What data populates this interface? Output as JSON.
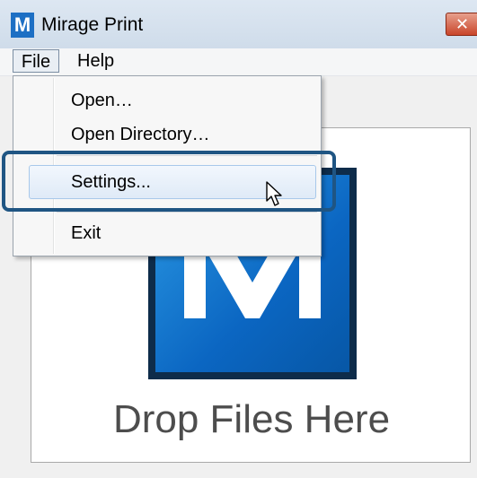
{
  "window": {
    "title": "Mirage Print",
    "app_icon_letter": "M",
    "close_glyph": "✕"
  },
  "menubar": {
    "file_label": "File",
    "help_label": "Help"
  },
  "file_menu": {
    "items": [
      {
        "label": "Open…",
        "highlighted": false
      },
      {
        "label": "Open Directory…",
        "highlighted": false
      },
      {
        "label": "Settings...",
        "highlighted": true
      },
      {
        "label": "Exit",
        "highlighted": false
      }
    ]
  },
  "drop_zone": {
    "text": "Drop Files Here",
    "logo_letter": "M"
  },
  "colors": {
    "accent_blue": "#1d6fc4",
    "logo_frame": "#0e2c4a",
    "highlight_outline": "#1f5583",
    "close_red": "#c9452a"
  },
  "icons": [
    "app-icon",
    "close-icon",
    "mirage-logo",
    "mouse-pointer-icon"
  ]
}
